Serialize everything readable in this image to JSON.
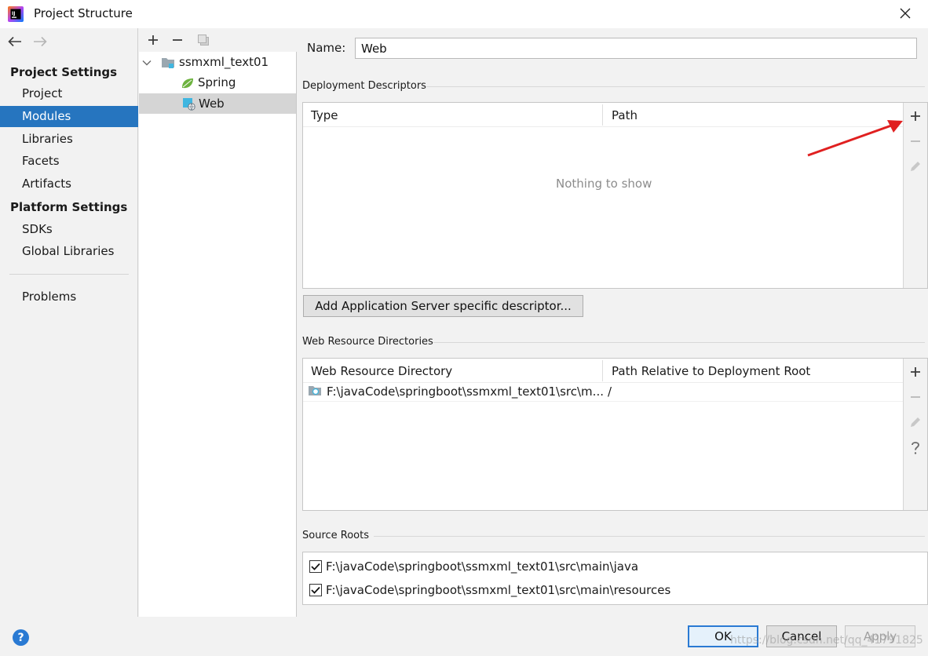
{
  "window": {
    "title": "Project Structure"
  },
  "sidebar": {
    "project_settings_header": "Project Settings",
    "platform_settings_header": "Platform Settings",
    "items": [
      {
        "label": "Project"
      },
      {
        "label": "Modules",
        "active": true
      },
      {
        "label": "Libraries"
      },
      {
        "label": "Facets"
      },
      {
        "label": "Artifacts"
      }
    ],
    "platform_items": [
      {
        "label": "SDKs"
      },
      {
        "label": "Global Libraries"
      }
    ],
    "problems": "Problems"
  },
  "tree": {
    "root": "ssmxml_text01",
    "children": [
      {
        "label": "Spring",
        "icon": "spring-leaf-icon"
      },
      {
        "label": "Web",
        "icon": "web-facet-icon",
        "selected": true
      }
    ]
  },
  "facet": {
    "name_label": "Name:",
    "name_value": "Web",
    "deployment_descriptors": {
      "title": "Deployment Descriptors",
      "columns": [
        "Type",
        "Path"
      ],
      "empty_text": "Nothing to show",
      "add_button": "Add Application Server specific descriptor..."
    },
    "web_resources": {
      "title": "Web Resource Directories",
      "columns": [
        "Web Resource Directory",
        "Path Relative to Deployment Root"
      ],
      "rows": [
        {
          "directory": "F:\\javaCode\\springboot\\ssmxml_text01\\src\\m...",
          "relative": "/"
        }
      ]
    },
    "source_roots": {
      "title": "Source Roots",
      "items": [
        {
          "path": "F:\\javaCode\\springboot\\ssmxml_text01\\src\\main\\java",
          "checked": true
        },
        {
          "path": "F:\\javaCode\\springboot\\ssmxml_text01\\src\\main\\resources",
          "checked": true
        }
      ]
    }
  },
  "footer": {
    "help": "?",
    "ok": "OK",
    "cancel": "Cancel",
    "apply": "Apply",
    "watermark": "https://blog.csdn.net/qq_41791825"
  },
  "colors": {
    "accent": "#2675bf",
    "annotation_arrow": "#e02020"
  }
}
